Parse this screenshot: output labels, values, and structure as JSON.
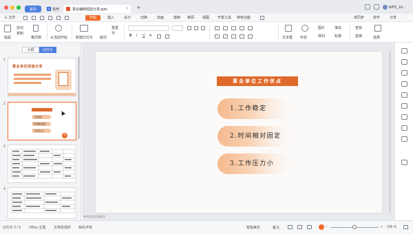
{
  "tabs": {
    "home": "首页",
    "doc": "稻壳",
    "doc_logo": "D",
    "ppt": "事业编制经验分享.pptx",
    "close": "×",
    "plus": "+"
  },
  "account": {
    "name": "WPS_16..."
  },
  "menu": {
    "file": "三 文件",
    "items": [
      "开始",
      "插入",
      "设计",
      "切换",
      "动画",
      "放映",
      "审阅",
      "视图",
      "开发工具",
      "特色功能"
    ],
    "start": "开始",
    "right": [
      "协作",
      "分享",
      "未同步"
    ]
  },
  "ribbon": {
    "paste": "粘贴",
    "cut": "剪切",
    "copy": "复制",
    "format_painter": "格式刷",
    "from_current": "从当前开始",
    "new_slide": "新建幻灯片",
    "layout": "版式",
    "reset": "重置",
    "section": "节",
    "text_box": "文本框",
    "shape": "形状",
    "arrange": "排列",
    "select": "选择",
    "replace": "替换",
    "picture": "图片",
    "fill": "填充",
    "outline": "轮廓",
    "find": "查找"
  },
  "left_panel": {
    "tab_outline": "大纲",
    "tab_slides": "幻灯片",
    "slide_numbers": [
      "1",
      "2",
      "3",
      "4"
    ],
    "thumb1_title": "事业单位经验分享",
    "thumb2_items": [
      "工作稳定",
      "时间相对固定",
      "工作压力小"
    ]
  },
  "slide": {
    "title": "事业单位工作优点",
    "items": [
      "1.工作稳定",
      "2.时间相对固定",
      "3.工作压力小"
    ]
  },
  "canvas": {
    "notes": "单击此处添加备注"
  },
  "status": {
    "slide_count": "幻灯片 2 / 5",
    "theme": "Office 主题",
    "doc_unprotected": "文档未保护",
    "missing_font": "缺失字体",
    "notes_toggle": "备注",
    "view_toggle": "智能美化",
    "zoom": "106 %"
  },
  "colors": {
    "accent": "#f06b2a",
    "title_bg": "#df6a2c",
    "tab_home": "#4c7de0"
  }
}
